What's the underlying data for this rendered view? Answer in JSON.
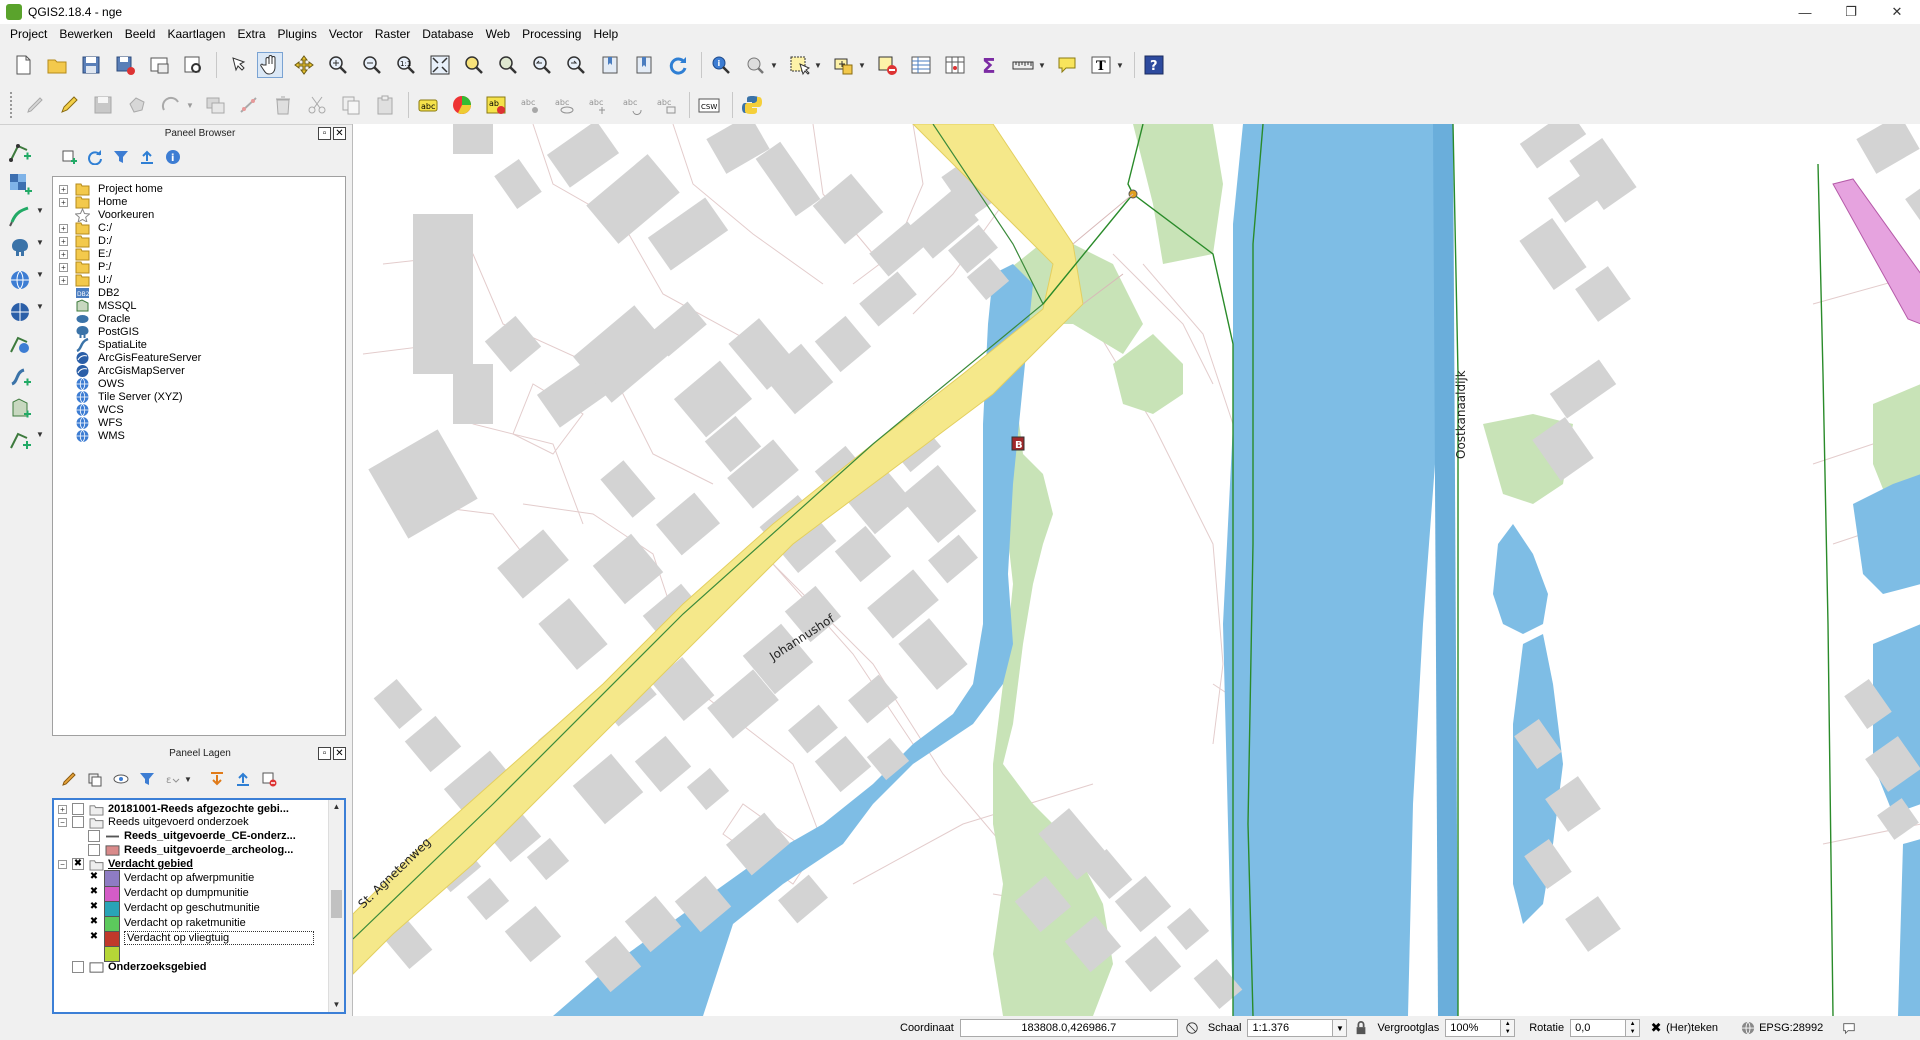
{
  "window": {
    "title": "QGIS2.18.4 - nge",
    "minimize": "—",
    "maximize": "❐",
    "close": "✕"
  },
  "menubar": [
    "Project",
    "Bewerken",
    "Beeld",
    "Kaartlagen",
    "Extra",
    "Plugins",
    "Vector",
    "Raster",
    "Database",
    "Web",
    "Processing",
    "Help"
  ],
  "browser_panel": {
    "title": "Paneel Browser",
    "items": [
      {
        "label": "Project home",
        "icon": "folder-icon",
        "expandable": true
      },
      {
        "label": "Home",
        "icon": "folder-icon",
        "expandable": true
      },
      {
        "label": "Voorkeuren",
        "icon": "star-icon",
        "expandable": false
      },
      {
        "label": "C:/",
        "icon": "folder-icon",
        "expandable": true
      },
      {
        "label": "D:/",
        "icon": "folder-icon",
        "expandable": true
      },
      {
        "label": "E:/",
        "icon": "folder-icon",
        "expandable": true
      },
      {
        "label": "P:/",
        "icon": "folder-icon",
        "expandable": true
      },
      {
        "label": "U:/",
        "icon": "folder-icon",
        "expandable": true
      },
      {
        "label": "DB2",
        "icon": "db2-icon",
        "expandable": false
      },
      {
        "label": "MSSQL",
        "icon": "mssql-icon",
        "expandable": false
      },
      {
        "label": "Oracle",
        "icon": "oracle-icon",
        "expandable": false
      },
      {
        "label": "PostGIS",
        "icon": "postgis-icon",
        "expandable": false
      },
      {
        "label": "SpatiaLite",
        "icon": "spatialite-icon",
        "expandable": false
      },
      {
        "label": "ArcGisFeatureServer",
        "icon": "arcgis-icon",
        "expandable": false
      },
      {
        "label": "ArcGisMapServer",
        "icon": "arcgis-icon",
        "expandable": false
      },
      {
        "label": "OWS",
        "icon": "globe-icon",
        "expandable": false
      },
      {
        "label": "Tile Server (XYZ)",
        "icon": "globe-icon",
        "expandable": false
      },
      {
        "label": "WCS",
        "icon": "globe-icon",
        "expandable": false
      },
      {
        "label": "WFS",
        "icon": "globe-icon",
        "expandable": false
      },
      {
        "label": "WMS",
        "icon": "globe-icon",
        "expandable": false
      }
    ]
  },
  "layers_panel": {
    "title": "Paneel Lagen",
    "layers": [
      {
        "label": "20181001-Reeds afgezochte gebi...",
        "type": "group",
        "bold": true,
        "checked": false,
        "expanded": false
      },
      {
        "label": "Reeds uitgevoerd onderzoek",
        "type": "group",
        "bold": false,
        "checked": false,
        "expanded": true
      },
      {
        "label": "Reeds_uitgevoerde_CE-onderz...",
        "type": "line-layer",
        "bold": true,
        "checked": false
      },
      {
        "label": "Reeds_uitgevoerde_archeolog...",
        "type": "poly-layer",
        "bold": true,
        "checked": false,
        "color": "#d98a8a"
      },
      {
        "label": "Verdacht gebied",
        "type": "group",
        "bold": true,
        "underline": true,
        "checked": true,
        "expanded": true
      },
      {
        "label": "Verdacht op afwerpmunitie",
        "type": "class",
        "checked": true,
        "color": "#8e7cc3"
      },
      {
        "label": "Verdacht op dumpmunitie",
        "type": "class",
        "checked": true,
        "color": "#d45cc7"
      },
      {
        "label": "Verdacht op geschutmunitie",
        "type": "class",
        "checked": true,
        "color": "#29a4b7"
      },
      {
        "label": "Verdacht op raketmunitie",
        "type": "class",
        "checked": true,
        "color": "#5cc95c"
      },
      {
        "label": "Verdacht op vliegtuig",
        "type": "class",
        "checked": true,
        "color": "#c0392b",
        "selected": true
      },
      {
        "label": "",
        "type": "class",
        "checked": false,
        "color": "#b5d637"
      },
      {
        "label": "Onderzoeksgebied",
        "type": "poly-layer",
        "bold": true,
        "checked": false,
        "color": "#ffffff"
      }
    ]
  },
  "map": {
    "labels": {
      "road1": "St. Agnetenweg",
      "road2": "Johannushof",
      "road3": "Oostkanaaldijk",
      "marker": "B"
    },
    "colors": {
      "building": "#d3d3d3",
      "water": "#7ebde5",
      "green": "#c8e3b7",
      "road_fill": "#f5e88a",
      "road_edge": "#e9d468",
      "line_green": "#2a8b2a",
      "parcel": "#e0c8c8",
      "dump_zone": "#e6a3df",
      "marker_fill": "#a0282a"
    }
  },
  "statusbar": {
    "coord_label": "Coordinaat",
    "coord_value": "183808.0,426986.7",
    "scale_label": "Schaal",
    "scale_value": "1:1.376",
    "magnifier_label": "Vergrootglas",
    "magnifier_value": "100%",
    "rotation_label": "Rotatie",
    "rotation_value": "0,0",
    "render_label": "(Her)teken",
    "crs_label": "EPSG:28992"
  }
}
